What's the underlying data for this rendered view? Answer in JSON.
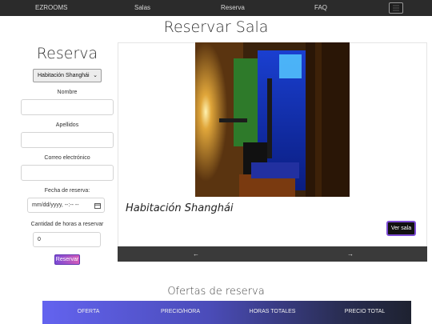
{
  "navbar": {
    "brand": "EZROOMS",
    "links": [
      "Salas",
      "Reserva",
      "FAQ"
    ],
    "toggle_icon": "hamburger-menu-icon"
  },
  "page_title": "Reservar Sala",
  "form": {
    "title": "Reserva",
    "room_select": {
      "value": "Habitación Shanghái"
    },
    "nombre_label": "Nombre",
    "apellidos_label": "Apellidos",
    "email_label": "Correo electrónico",
    "fecha_label": "Fecha de reserva:",
    "fecha_placeholder": "mm/dd/yyyy, --:-- --",
    "horas_label": "Cantidad de horas a reservar",
    "horas_value": "0",
    "submit_label": "Reservar"
  },
  "carousel": {
    "slide_title": "Habitación Shanghái",
    "view_button": "Ver sala",
    "prev": "←",
    "next": "→"
  },
  "offers": {
    "title": "Ofertas de reserva",
    "headers": [
      "OFERTA",
      "PRECIO/HORA",
      "HORAS TOTALES",
      "PRECIO TOTAL"
    ]
  },
  "colors": {
    "navbar_bg": "#2b2b2b",
    "accent_purple": "#7d4cd6",
    "table_header_start": "#6363ef",
    "table_header_end": "#1e2230"
  }
}
